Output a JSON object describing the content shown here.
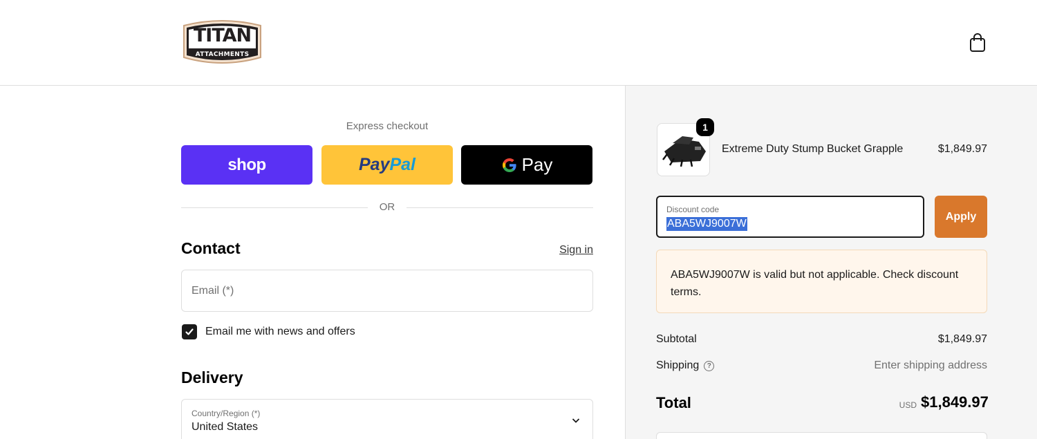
{
  "brand": {
    "logo_line1": "TITAN",
    "logo_line2": "ATTACHMENTS",
    "accent_color": "#d9782c"
  },
  "header": {
    "cart_icon": "shopping-bag-icon"
  },
  "express": {
    "label": "Express checkout",
    "shop_label": "shop",
    "paypal_label_a": "Pay",
    "paypal_label_b": "Pal",
    "gpay_label": "Pay",
    "or_label": "OR"
  },
  "contact": {
    "title": "Contact",
    "signin_label": "Sign in",
    "email_placeholder": "Email (*)",
    "email_value": "",
    "newsletter_label": "Email me with news and offers",
    "newsletter_checked": true
  },
  "delivery": {
    "title": "Delivery",
    "country_label": "Country/Region (*)",
    "country_value": "United States"
  },
  "order": {
    "item": {
      "name": "Extreme Duty Stump Bucket Grapple",
      "price": "$1,849.97",
      "quantity": "1"
    },
    "discount": {
      "label": "Discount code",
      "value": "ABA5WJ9007W",
      "apply_label": "Apply",
      "notice": "ABA5WJ9007W is valid but not applicable. Check discount terms."
    },
    "subtotal_label": "Subtotal",
    "subtotal_value": "$1,849.97",
    "shipping_label": "Shipping",
    "shipping_help_icon": "?",
    "shipping_value": "Enter shipping address",
    "total_label": "Total",
    "total_currency": "USD",
    "total_value": "$1,849.97"
  }
}
